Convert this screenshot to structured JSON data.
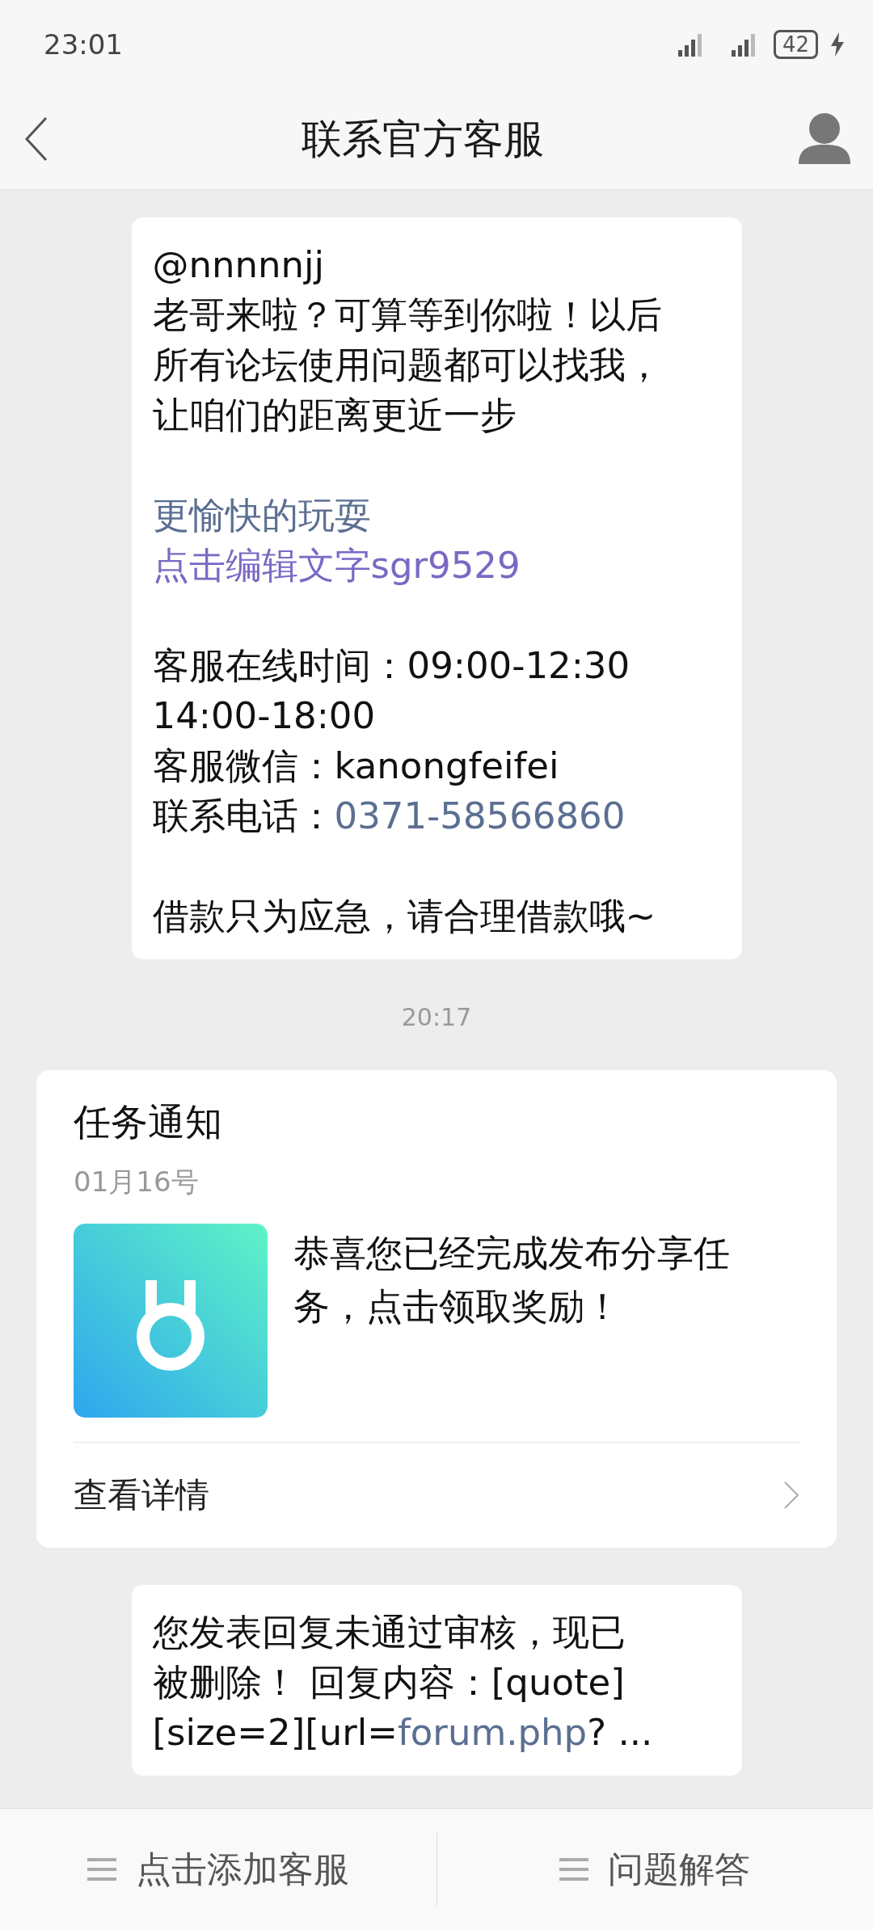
{
  "status_bar": {
    "time": "23:01",
    "battery": "42"
  },
  "header": {
    "title": "联系官方客服"
  },
  "messages": [
    {
      "kind": "bubble",
      "lines": [
        {
          "kind": "text",
          "segments": [
            {
              "text": "@nnnnnjj",
              "link": false
            }
          ]
        },
        {
          "kind": "text",
          "segments": [
            {
              "text": "老哥来啦？可算等到你啦！以后",
              "link": false
            }
          ]
        },
        {
          "kind": "text",
          "segments": [
            {
              "text": "所有论坛使用问题都可以找我，",
              "link": false
            }
          ]
        },
        {
          "kind": "text",
          "segments": [
            {
              "text": "让咱们的距离更近一步",
              "link": false
            }
          ]
        },
        {
          "kind": "gap"
        },
        {
          "kind": "overlap",
          "under": "更愉快的玩耍",
          "over": "点击编辑文字sgr9529"
        },
        {
          "kind": "gap"
        },
        {
          "kind": "text",
          "segments": [
            {
              "text": "客服在线时间：09:00-12:30",
              "link": false
            }
          ]
        },
        {
          "kind": "text",
          "segments": [
            {
              "text": "14:00-18:00",
              "link": false
            }
          ]
        },
        {
          "kind": "text",
          "segments": [
            {
              "text": "客服微信：kanongfeifei",
              "link": false
            }
          ]
        },
        {
          "kind": "text",
          "segments": [
            {
              "text": "联系电话：",
              "link": false
            },
            {
              "text": "0371-58566860",
              "link": true
            }
          ]
        },
        {
          "kind": "gap"
        },
        {
          "kind": "text",
          "segments": [
            {
              "text": "借款只为应急，请合理借款哦~",
              "link": false
            }
          ]
        }
      ]
    },
    {
      "kind": "time",
      "text": "20:17"
    },
    {
      "kind": "card",
      "title": "任务通知",
      "date": "01月16号",
      "body": "恭喜您已经完成发布分享任务，点击领取奖励！",
      "action": "查看详情"
    },
    {
      "kind": "bubble",
      "lines": [
        {
          "kind": "text",
          "segments": [
            {
              "text": "您发表回复未通过审核，现已",
              "link": false
            }
          ]
        },
        {
          "kind": "text",
          "segments": [
            {
              "text": "被删除！ 回复内容：[quote]",
              "link": false
            }
          ]
        },
        {
          "kind": "text",
          "segments": [
            {
              "text": "[size=2][url=",
              "link": false
            },
            {
              "text": "forum.php",
              "link": true
            },
            {
              "text": "? ...",
              "link": false
            }
          ]
        }
      ]
    }
  ],
  "bottom_bar": [
    {
      "label": "点击添加客服"
    },
    {
      "label": "问题解答"
    }
  ]
}
